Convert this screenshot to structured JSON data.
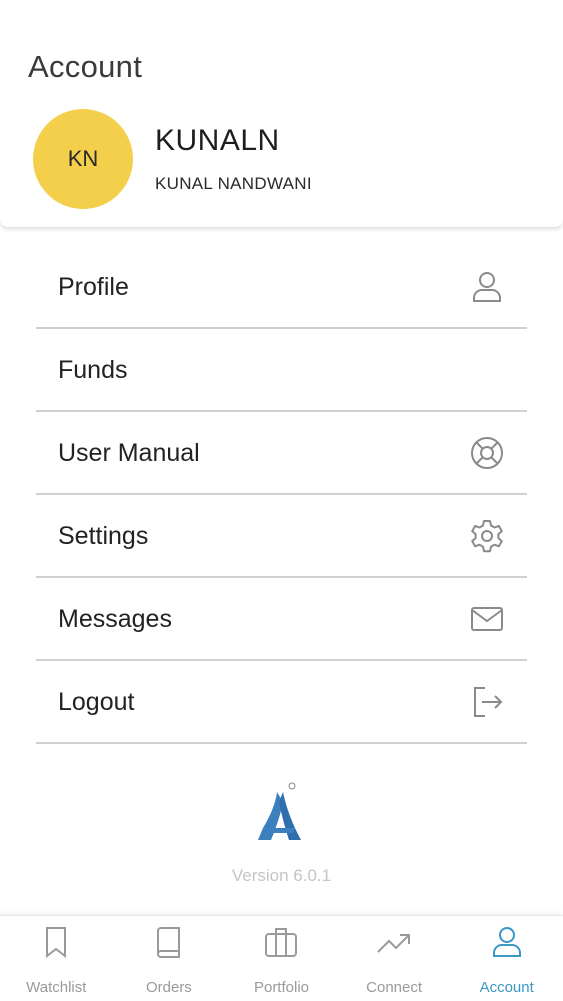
{
  "header": {
    "title": "Account",
    "avatar_initials": "KN",
    "username": "KUNALN",
    "full_name": "KUNAL NANDWANI",
    "avatar_color": "#f3cf4c"
  },
  "menu": {
    "items": [
      {
        "label": "Profile",
        "icon": "user-icon"
      },
      {
        "label": "Funds",
        "icon": ""
      },
      {
        "label": "User Manual",
        "icon": "lifebuoy-icon"
      },
      {
        "label": "Settings",
        "icon": "gear-icon"
      },
      {
        "label": "Messages",
        "icon": "mail-icon"
      },
      {
        "label": "Logout",
        "icon": "logout-icon"
      }
    ]
  },
  "footer": {
    "version": "Version 6.0.1",
    "logo": "app-logo-icon"
  },
  "tabs": [
    {
      "label": "Watchlist",
      "icon": "bookmark-icon",
      "active": false
    },
    {
      "label": "Orders",
      "icon": "book-icon",
      "active": false
    },
    {
      "label": "Portfolio",
      "icon": "briefcase-icon",
      "active": false
    },
    {
      "label": "Connect",
      "icon": "trending-up-icon",
      "active": false
    },
    {
      "label": "Account",
      "icon": "user-icon",
      "active": true
    }
  ],
  "colors": {
    "accent": "#3a97c6",
    "inactive": "#9a9a9a",
    "status_indicator": "#f2c230"
  }
}
